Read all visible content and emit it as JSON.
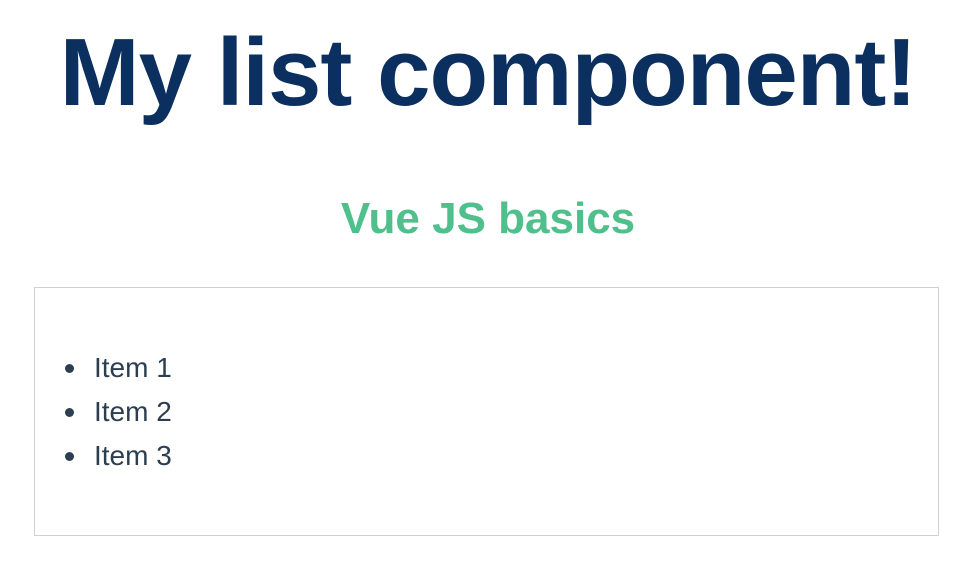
{
  "header": {
    "title": "My list component!",
    "subtitle": "Vue JS basics"
  },
  "list": {
    "items": [
      {
        "label": "Item 1"
      },
      {
        "label": "Item 2"
      },
      {
        "label": "Item 3"
      }
    ]
  },
  "colors": {
    "title": "#0b2f5e",
    "subtitle": "#4fbf8b",
    "text": "#2c3e50",
    "border": "#d0d0d0"
  }
}
